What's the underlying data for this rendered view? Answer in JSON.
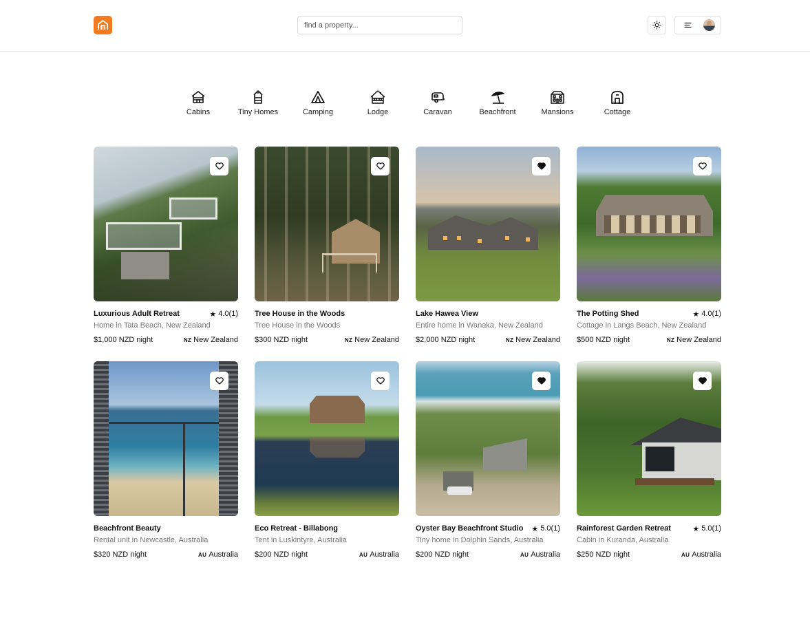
{
  "header": {
    "search_placeholder": "find a property..."
  },
  "categories": [
    {
      "label": "Cabins",
      "icon": "cabin-icon"
    },
    {
      "label": "Tiny Homes",
      "icon": "tiny-home-icon"
    },
    {
      "label": "Camping",
      "icon": "tent-icon"
    },
    {
      "label": "Lodge",
      "icon": "lodge-icon"
    },
    {
      "label": "Caravan",
      "icon": "caravan-icon"
    },
    {
      "label": "Beachfront",
      "icon": "umbrella-icon"
    },
    {
      "label": "Mansions",
      "icon": "mansion-icon"
    },
    {
      "label": "Cottage",
      "icon": "cottage-icon"
    }
  ],
  "listings": [
    {
      "title": "Luxurious Adult Retreat",
      "rating": "4.0(1)",
      "subtitle": "Home in Tata Beach, New Zealand",
      "price": "$1,000 NZD night",
      "country_code": "NZ",
      "country": "New Zealand",
      "favorited": false
    },
    {
      "title": "Tree House in the Woods",
      "rating": "",
      "subtitle": "Tree House in the Woods",
      "price": "$300 NZD night",
      "country_code": "NZ",
      "country": "New Zealand",
      "favorited": false
    },
    {
      "title": "Lake Hawea View",
      "rating": "",
      "subtitle": "Entire home in Wanaka, New Zealand",
      "price": "$2,000 NZD night",
      "country_code": "NZ",
      "country": "New Zealand",
      "favorited": true
    },
    {
      "title": "The Potting Shed",
      "rating": "4.0(1)",
      "subtitle": "Cottage in Langs Beach, New Zealand",
      "price": "$500 NZD night",
      "country_code": "NZ",
      "country": "New Zealand",
      "favorited": false
    },
    {
      "title": "Beachfront Beauty",
      "rating": "",
      "subtitle": "Rental unit in Newcastle, Australia",
      "price": "$320 NZD night",
      "country_code": "AU",
      "country": "Australia",
      "favorited": false
    },
    {
      "title": "Eco Retreat - Billabong",
      "rating": "",
      "subtitle": "Tent in Luskintyre, Australia",
      "price": "$200 NZD night",
      "country_code": "AU",
      "country": "Australia",
      "favorited": false
    },
    {
      "title": "Oyster Bay Beachfront Studio",
      "rating": "5.0(1)",
      "subtitle": "Tiny home in Dolphin Sands, Australia",
      "price": "$200 NZD night",
      "country_code": "AU",
      "country": "Australia",
      "favorited": true
    },
    {
      "title": "Rainforest Garden Retreat",
      "rating": "5.0(1)",
      "subtitle": "Cabin in Kuranda, Australia",
      "price": "$250 NZD night",
      "country_code": "AU",
      "country": "Australia",
      "favorited": true
    }
  ],
  "colors": {
    "brand": "#f47a1f",
    "border": "#e6e6e6",
    "muted_text": "#777777"
  }
}
